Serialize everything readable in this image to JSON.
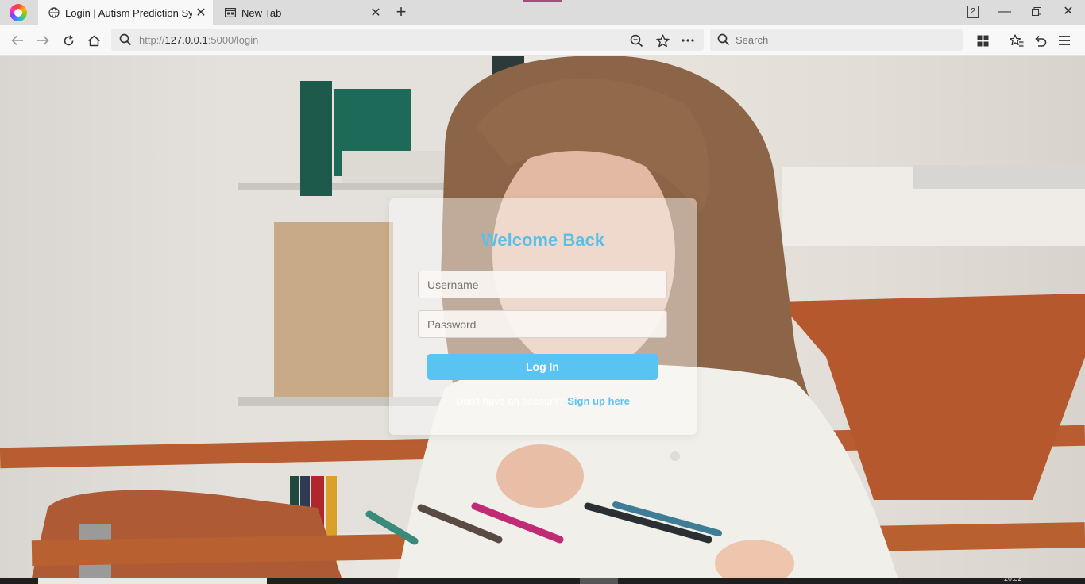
{
  "browser": {
    "tabs": [
      {
        "title": "Login | Autism Prediction Syst",
        "active": true,
        "icon": "globe-icon"
      },
      {
        "title": "New Tab",
        "active": false,
        "icon": "newtab-page-icon"
      }
    ],
    "window_count": "2",
    "url": {
      "scheme": "http://",
      "host": "127.0.0.1",
      "rest": ":5000/login"
    },
    "search_placeholder": "Search",
    "accent_color": "#a24d7a"
  },
  "page": {
    "heading": "Welcome Back",
    "username_placeholder": "Username",
    "password_placeholder": "Password",
    "login_button": "Log In",
    "signup_prompt": "Don't have an account?",
    "signup_link": "Sign up here",
    "accent_color": "#59c3f2"
  },
  "taskbar": {
    "clock": "20:52"
  }
}
